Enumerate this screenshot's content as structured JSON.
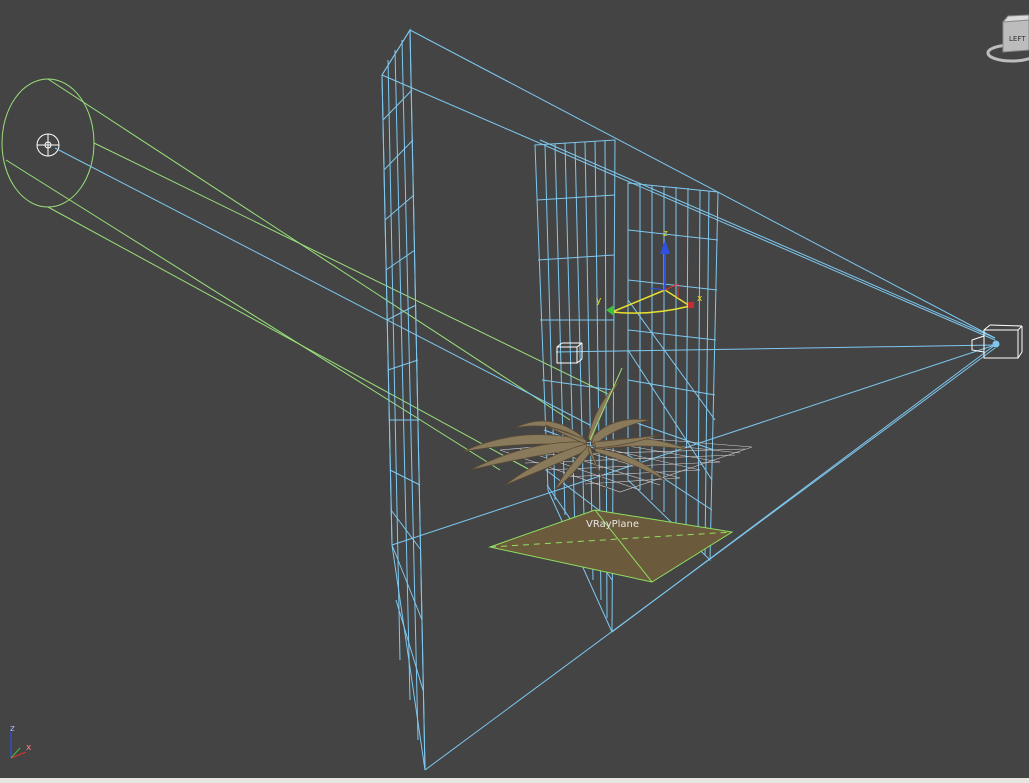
{
  "viewport": {
    "background": "#444444",
    "wire_color": "#7ec8f0",
    "light_color": "#9ae07a",
    "ground_plane_fill": "#6b5a3c",
    "ground_plane_stroke": "#8fe060",
    "object_label": "VRayPlane"
  },
  "viewcube": {
    "face_label": "LEFT"
  },
  "gizmo": {
    "x_label": "x",
    "y_label": "y",
    "z_label": "z",
    "x_color": "#e03030",
    "y_color": "#40c040",
    "z_color": "#3050e0"
  },
  "world_axes": {
    "x_label": "x",
    "z_label": "z"
  }
}
